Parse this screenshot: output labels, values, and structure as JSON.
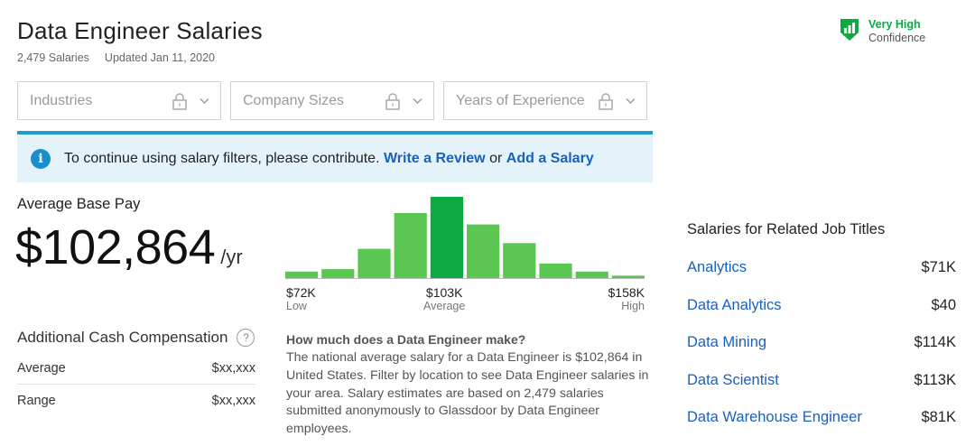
{
  "header": {
    "title": "Data Engineer Salaries",
    "count": "2,479 Salaries",
    "updated": "Updated Jan 11, 2020"
  },
  "confidence": {
    "level": "Very High",
    "label": "Confidence",
    "icon": "shield-bars-icon",
    "color": "#0caa41"
  },
  "filters": [
    {
      "label": "Industries",
      "icon": "lock-icon"
    },
    {
      "label": "Company Sizes",
      "icon": "lock-icon"
    },
    {
      "label": "Years of Experience",
      "icon": "lock-icon"
    }
  ],
  "banner": {
    "text": "To continue using salary filters, please contribute.",
    "link1": "Write a Review",
    "or": "or",
    "link2": "Add a Salary",
    "icon": "info-icon"
  },
  "average": {
    "label": "Average Base Pay",
    "amount": "$102,864",
    "unit": "/yr"
  },
  "additional": {
    "title": "Additional Cash Compensation",
    "help": "?",
    "rows": [
      {
        "label": "Average",
        "value": "$xx,xxx"
      },
      {
        "label": "Range",
        "value": "$xx,xxx"
      }
    ]
  },
  "histogram": {
    "low_value": "$72K",
    "low_label": "Low",
    "mid_value": "$103K",
    "mid_label": "Average",
    "high_value": "$158K",
    "high_label": "High",
    "bars": [
      0.08,
      0.11,
      0.36,
      0.8,
      1.0,
      0.66,
      0.43,
      0.18,
      0.08,
      0.03
    ],
    "highlight_index": 4,
    "color": "#5cc653",
    "highlight_color": "#0caa41"
  },
  "how": {
    "title": "How much does a Data Engineer make?",
    "text": "The national average salary for a Data Engineer is $102,864 in United States. Filter by location to see Data Engineer salaries in your area. Salary estimates are based on 2,479 salaries submitted anonymously to Glassdoor by Data Engineer employees."
  },
  "related": {
    "title": "Salaries for Related Job Titles",
    "items": [
      {
        "title": "Analytics",
        "value": "$71K"
      },
      {
        "title": "Data Analytics",
        "value": "$40"
      },
      {
        "title": "Data Mining",
        "value": "$114K"
      },
      {
        "title": "Data Scientist",
        "value": "$113K"
      },
      {
        "title": "Data Warehouse Engineer",
        "value": "$81K"
      }
    ]
  }
}
